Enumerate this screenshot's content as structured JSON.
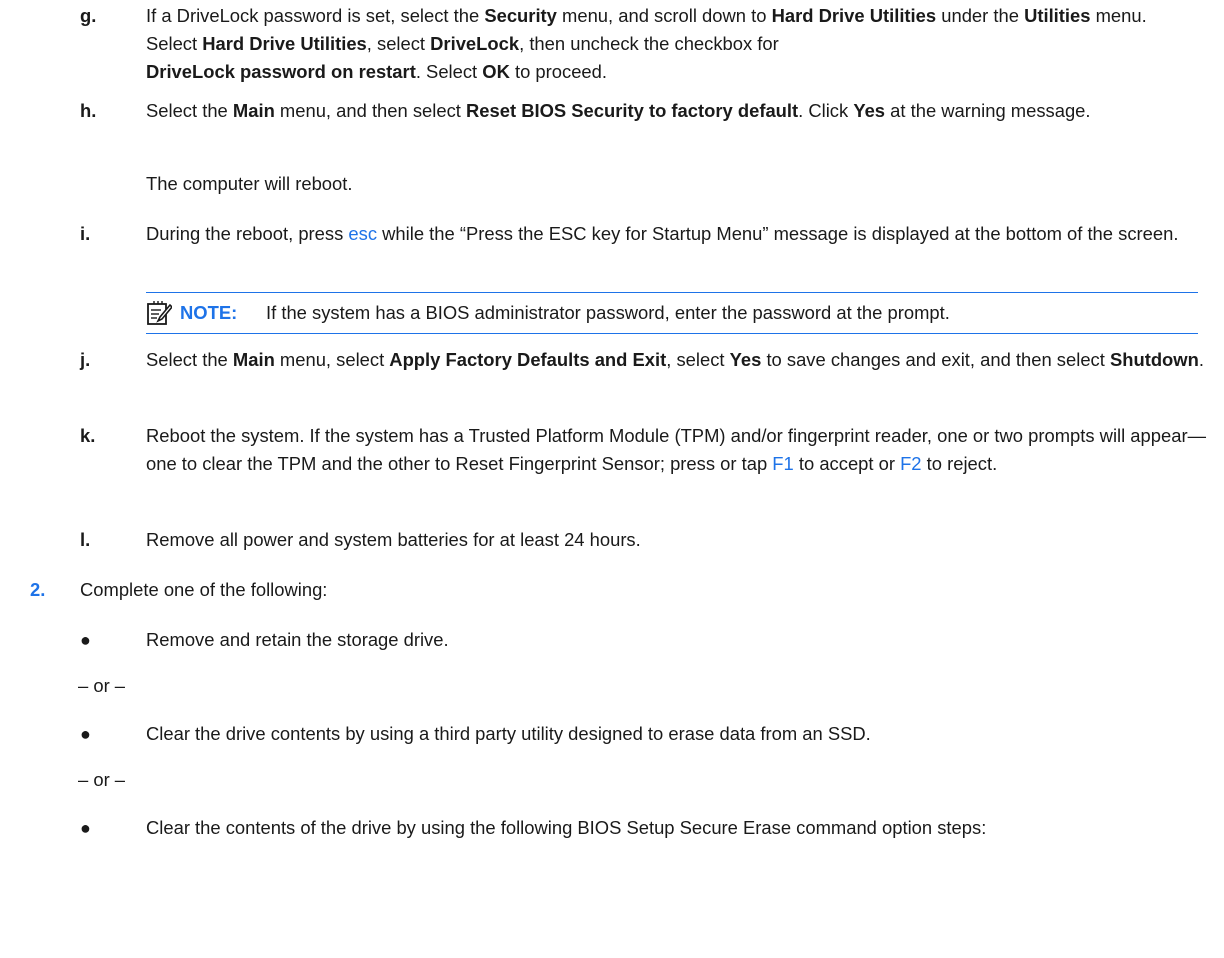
{
  "steps": {
    "g": {
      "marker": "g.",
      "parts": [
        "If a DriveLock password is set, select the ",
        "Security",
        " menu, and scroll down to ",
        "Hard Drive Utilities",
        " under the ",
        "Utilities",
        " menu. Select ",
        "Hard Drive Utilities",
        ", select ",
        "DriveLock",
        ", then uncheck the checkbox for ",
        "DriveLock password on restart",
        ". Select ",
        "OK",
        " to proceed."
      ]
    },
    "h": {
      "marker": "h.",
      "parts": [
        "Select the ",
        "Main",
        " menu, and then select ",
        "Reset BIOS Security to factory default",
        ". Click ",
        "Yes",
        " at the warning message."
      ],
      "followup": "The computer will reboot."
    },
    "i": {
      "marker": "i.",
      "parts": [
        "During the reboot, press ",
        "esc",
        " while the “Press the ESC key for Startup Menu” message is displayed at the bottom of the screen."
      ]
    },
    "note": {
      "label": "NOTE:",
      "text": "If the system has a BIOS administrator password, enter the password at the prompt."
    },
    "j": {
      "marker": "j.",
      "parts": [
        "Select the ",
        "Main",
        " menu, select ",
        "Apply Factory Defaults and Exit",
        ", select ",
        "Yes",
        " to save changes and exit, and then select ",
        "Shutdown",
        "."
      ]
    },
    "k": {
      "marker": "k.",
      "parts": [
        "Reboot the system. If the system has a Trusted Platform Module (TPM) and/or fingerprint reader, one or two prompts will appear—one to clear the TPM and the other to Reset Fingerprint Sensor; press or tap ",
        "F1",
        " to accept or ",
        "F2",
        " to reject."
      ]
    },
    "l": {
      "marker": "l.",
      "text": "Remove all power and system batteries for at least 24 hours."
    }
  },
  "step2": {
    "marker": "2.",
    "text": "Complete one of the following:",
    "bullets": [
      "Remove and retain the storage drive.",
      "Clear the drive contents by using a third party utility designed to erase data from an SSD.",
      "Clear the contents of the drive by using the following BIOS Setup Secure Erase command option steps:"
    ],
    "separator": "– or –"
  },
  "colors": {
    "accent": "#1e73e8",
    "text": "#1a1a1a"
  }
}
